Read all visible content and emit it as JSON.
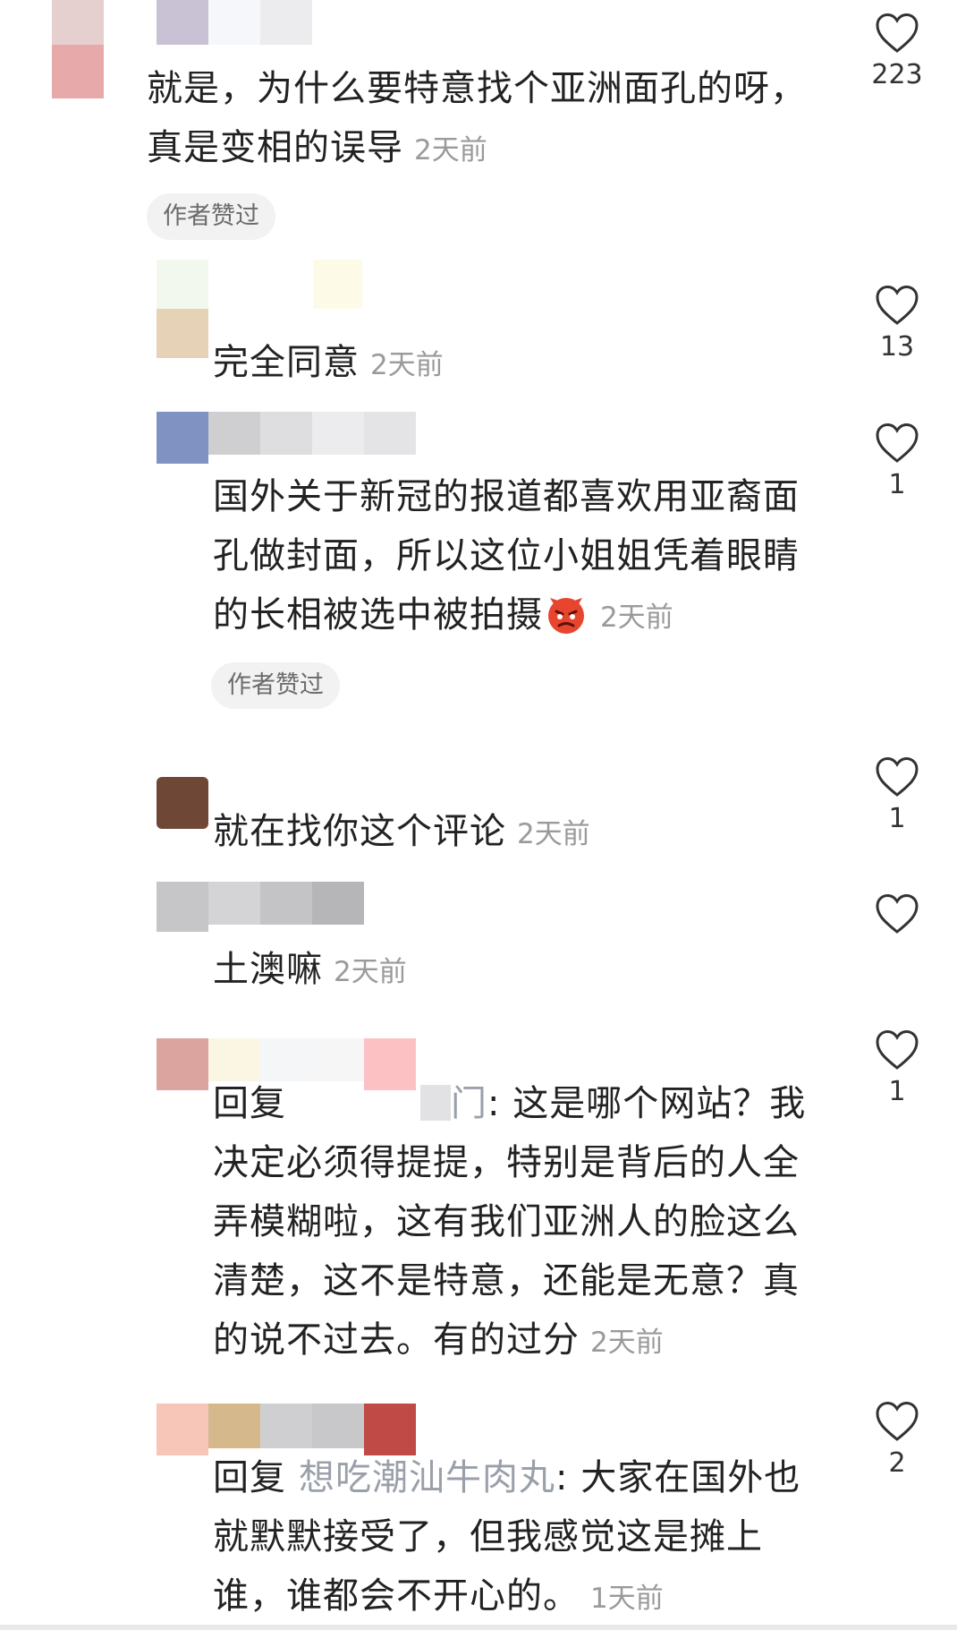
{
  "comments": [
    {
      "text_lines": [
        "就是，为什么要特意找个亚洲面孔的呀，",
        "真是变相的误导"
      ],
      "time": "2天前",
      "author_liked": "作者赞过",
      "likes": "223"
    },
    {
      "text_lines": [
        "完全同意"
      ],
      "time": "2天前",
      "likes": "13"
    },
    {
      "text_lines": [
        "国外关于新冠的报道都喜欢用亚裔面",
        "孔做封面，所以这位小姐姐凭着眼睛",
        "的长相被选中被拍摄"
      ],
      "emoji": "angry-devil-emoji",
      "time": "2天前",
      "author_liked": "作者赞过",
      "likes": "1"
    },
    {
      "text_lines": [
        "就在找你这个评论"
      ],
      "time": "2天前",
      "likes": "1"
    },
    {
      "text_lines": [
        "土澳嘛"
      ],
      "time": "2天前",
      "likes": ""
    },
    {
      "reply_prefix": "回复",
      "reply_name_tail": "门",
      "reply_colon": ": ",
      "text_lines": [
        "这是哪个网站？我",
        "决定必须得提提，特别是背后的人全",
        "弄模糊啦，这有我们亚洲人的脸这么",
        "清楚，这不是特意，还能是无意？真",
        "的说不过去。有的过分"
      ],
      "time": "2天前",
      "likes": "1"
    },
    {
      "reply_prefix": "回复",
      "reply_name": "想吃潮汕牛肉丸",
      "reply_colon": ": ",
      "text_lines": [
        "大家在国外也",
        "就默默接受了，但我感觉这是摊上",
        "谁，谁都会不开心的。"
      ],
      "time": "1天前",
      "likes": "2"
    }
  ],
  "colors": {
    "text": "#222222",
    "time": "#9a9a9a",
    "reply_name": "#9aa0aa",
    "badge_bg": "#f2f2f2",
    "like_icon": "#333333"
  }
}
